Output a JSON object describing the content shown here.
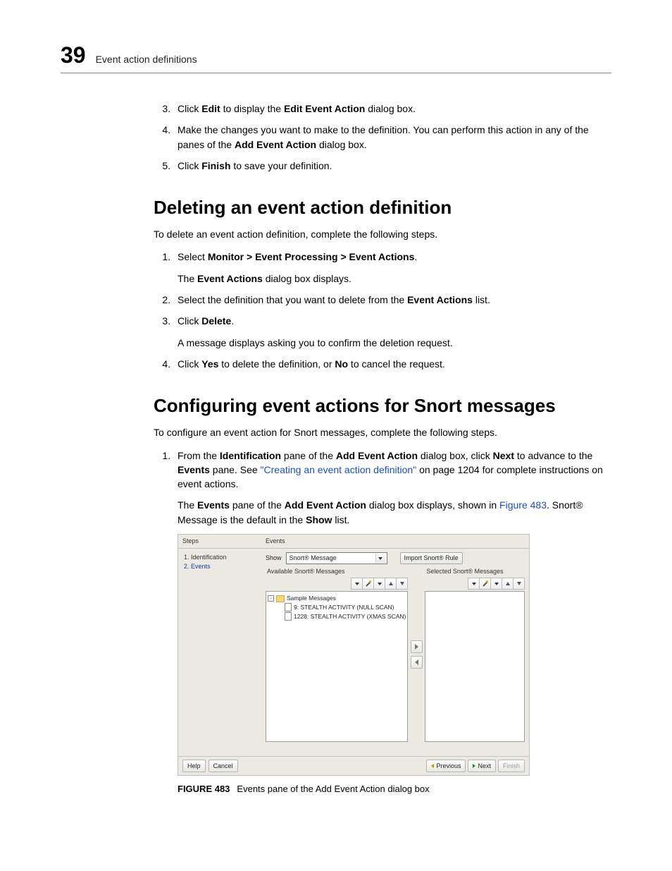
{
  "header": {
    "chapter_number": "39",
    "title": "Event action definitions"
  },
  "editing_steps": [
    {
      "num": "3.",
      "parts": [
        "Click ",
        {
          "b": "Edit"
        },
        " to display the ",
        {
          "b": "Edit Event Action"
        },
        " dialog box."
      ]
    },
    {
      "num": "4.",
      "parts": [
        "Make the changes you want to make to the definition. You can perform this action in any of the panes of the ",
        {
          "b": "Add Event Action"
        },
        " dialog box."
      ]
    },
    {
      "num": "5.",
      "parts": [
        "Click ",
        {
          "b": "Finish"
        },
        " to save your definition."
      ]
    }
  ],
  "section_delete": {
    "heading": "Deleting an event action definition",
    "intro": "To delete an event action definition, complete the following steps.",
    "steps": [
      {
        "num": "1.",
        "parts": [
          "Select ",
          {
            "b": "Monitor > Event Processing > Event Actions"
          },
          "."
        ],
        "sub": [
          "The ",
          {
            "b": "Event Actions"
          },
          " dialog box displays."
        ]
      },
      {
        "num": "2.",
        "parts": [
          "Select the definition that you want to delete from the ",
          {
            "b": "Event Actions"
          },
          " list."
        ]
      },
      {
        "num": "3.",
        "parts": [
          "Click ",
          {
            "b": "Delete"
          },
          "."
        ],
        "sub": [
          "A message displays asking you to confirm the deletion request."
        ]
      },
      {
        "num": "4.",
        "parts": [
          "Click ",
          {
            "b": "Yes"
          },
          " to delete the definition, or ",
          {
            "b": "No"
          },
          " to cancel the request."
        ]
      }
    ]
  },
  "section_snort": {
    "heading": "Configuring event actions for Snort messages",
    "intro": "To configure an event action for Snort messages, complete the following steps.",
    "step1": {
      "num": "1.",
      "text_a": "From the ",
      "b1": "Identification",
      "text_b": " pane of the ",
      "b2": "Add Event Action",
      "text_c": " dialog box, click ",
      "b3": "Next",
      "text_d": " to advance to the ",
      "b4": "Events",
      "text_e": " pane. See ",
      "link": "\"Creating an event action definition\"",
      "text_f": " on page 1204 for complete instructions on event actions.",
      "sub_a": "The ",
      "sub_b1": "Events",
      "sub_b": " pane of the ",
      "sub_b2": "Add Event Action",
      "sub_c": " dialog box displays, shown in ",
      "sub_link": "Figure 483",
      "sub_d": ". Snort® Message is the default in the ",
      "sub_b3": "Show",
      "sub_e": " list."
    }
  },
  "dialog": {
    "steps_title": "Steps",
    "events_title": "Events",
    "step_items": [
      "1. Identification",
      "2. Events"
    ],
    "show_label": "Show",
    "show_value": "Snort® Message",
    "import_btn": "Import Snort® Rule",
    "avail_title": "Available Snort® Messages",
    "sel_title": "Selected Snort® Messages",
    "tree": {
      "root": "Sample Messages",
      "items": [
        "9: STEALTH ACTIVITY (NULL SCAN)",
        "1228: STEALTH ACTIVITY (XMAS SCAN)"
      ]
    },
    "footer": {
      "help": "Help",
      "cancel": "Cancel",
      "previous": "Previous",
      "next": "Next",
      "finish": "Finish"
    }
  },
  "caption": {
    "lead": "FIGURE 483",
    "text": "Events pane of the Add Event Action dialog box"
  }
}
